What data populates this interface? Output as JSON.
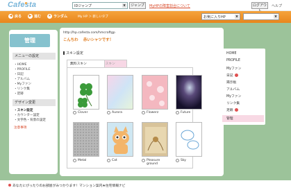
{
  "brand": {
    "logo": "Cafesta"
  },
  "topbar": {
    "id_select_value": "IDジャンプ",
    "jump_label": "ジャンプ",
    "notice": "MyHPの障害割合について",
    "login_label": "ログアウト",
    "help_label": "ヘルプ"
  },
  "nav": {
    "back_label": "戻る",
    "forward_label": "進む",
    "random_label": "ランダム",
    "crumb": "My HP ＞ 新しいタブ",
    "fav_select_value": "お気に入りHP",
    "blank_select_value": ""
  },
  "left": {
    "kanri": "管理",
    "menu_settings_head": "メニューの設定",
    "menu_items": [
      "・HOME",
      "・PROFILE",
      "・日記",
      "・アルバム",
      "・Myファン",
      "・リンク集",
      "・足跡"
    ],
    "design_head": "デザイン変更",
    "design_items": [
      "・スキン設定",
      "・カウンター設定",
      "・文字色・背景の設定"
    ],
    "notice": "注意事項"
  },
  "main": {
    "url": "http://hp.cafesta.com/hmcraftgp",
    "title": "こんちわ 　赤いシャツです！",
    "section": "スキン設定",
    "tabs": [
      "無料スキン",
      "有料スキン"
    ],
    "skins": [
      {
        "name": "Clover",
        "icon": "clover-icon"
      },
      {
        "name": "Aurora",
        "icon": "aurora-icon"
      },
      {
        "name": "Flowerz",
        "icon": "flower-icon"
      },
      {
        "name": "Future",
        "icon": "future-icon"
      },
      {
        "name": "Metal",
        "icon": "metal-icon"
      },
      {
        "name": "Cat",
        "icon": "cat-icon"
      },
      {
        "name": "Pleasure ground",
        "icon": "pleasure-icon"
      },
      {
        "name": "Sky",
        "icon": "sky-icon"
      }
    ]
  },
  "right": {
    "items": [
      "HOME",
      "PROFILE",
      "Myファン",
      "日記",
      "掲示板",
      "アルバム",
      "Myファン",
      "リンク集",
      "足跡",
      "管理"
    ]
  },
  "bottom": {
    "text": "あなたにぴったりのお部屋がみつかります！マンション案内★住宅情報ナビ"
  },
  "colors": {
    "background": "#9cc39a",
    "orange_nav": "#ec8f24",
    "accent_blue": "#86c2ce",
    "title_orange": "#e07a1a",
    "inactive_tab": "#f7d7e5"
  }
}
